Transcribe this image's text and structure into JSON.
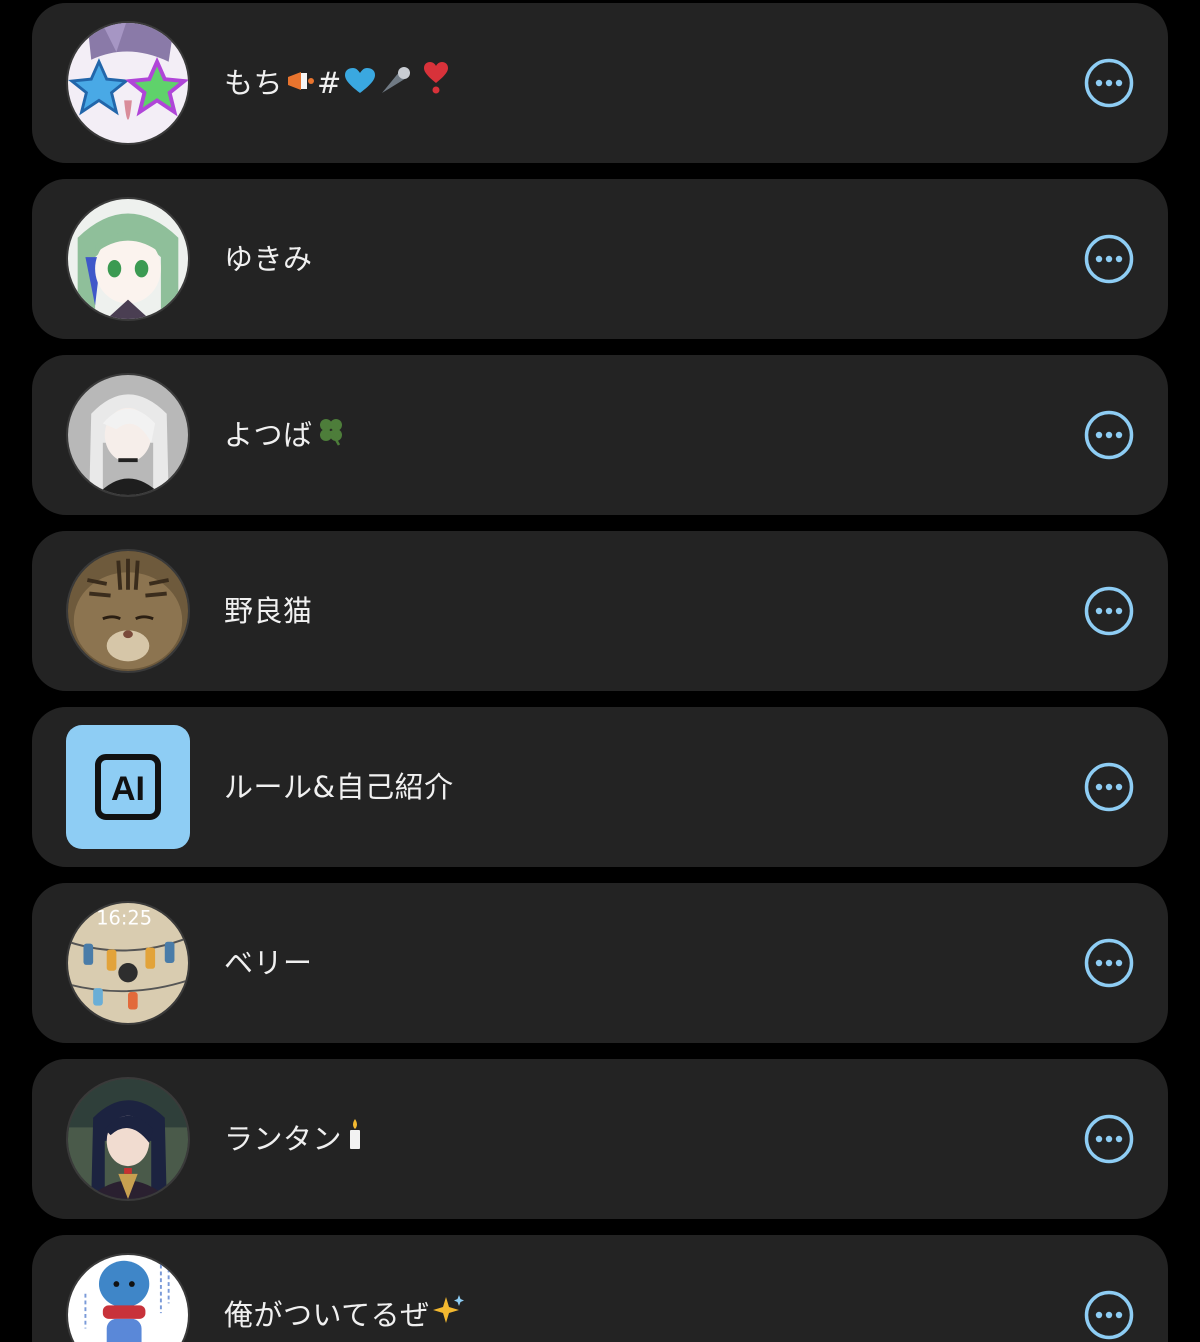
{
  "members": [
    {
      "name": "もち",
      "name_suffix": "#",
      "avatar": "anime-star-glasses-avatar",
      "emojis": [
        "megaphone",
        "blue-heart",
        "comet",
        "red-heart-exclamation"
      ]
    },
    {
      "name": "ゆきみ",
      "avatar": "anime-green-hair-avatar",
      "emojis": []
    },
    {
      "name": "よつば",
      "avatar": "anime-white-hair-avatar",
      "emojis": [
        "four-leaf-clover"
      ]
    },
    {
      "name": "野良猫",
      "avatar": "cat-photo-avatar",
      "emojis": []
    },
    {
      "name": "ルール&自己紹介",
      "avatar": "ai-logo-avatar",
      "avatar_text": "AI",
      "emojis": []
    },
    {
      "name": "ベリー",
      "avatar": "socks-illustration-avatar",
      "avatar_text": "16:25",
      "emojis": []
    },
    {
      "name": "ランタン",
      "avatar": "anime-dark-hair-avatar",
      "emojis": [
        "candle"
      ]
    },
    {
      "name": "俺がついてるぜ",
      "avatar": "blue-creature-avatar",
      "emojis": [
        "sparkles"
      ]
    }
  ],
  "more_button_icon": "more-options-icon",
  "colors": {
    "background": "#000000",
    "card": "#232323",
    "accent": "#8ecdf4",
    "text": "#f0f0f0"
  }
}
